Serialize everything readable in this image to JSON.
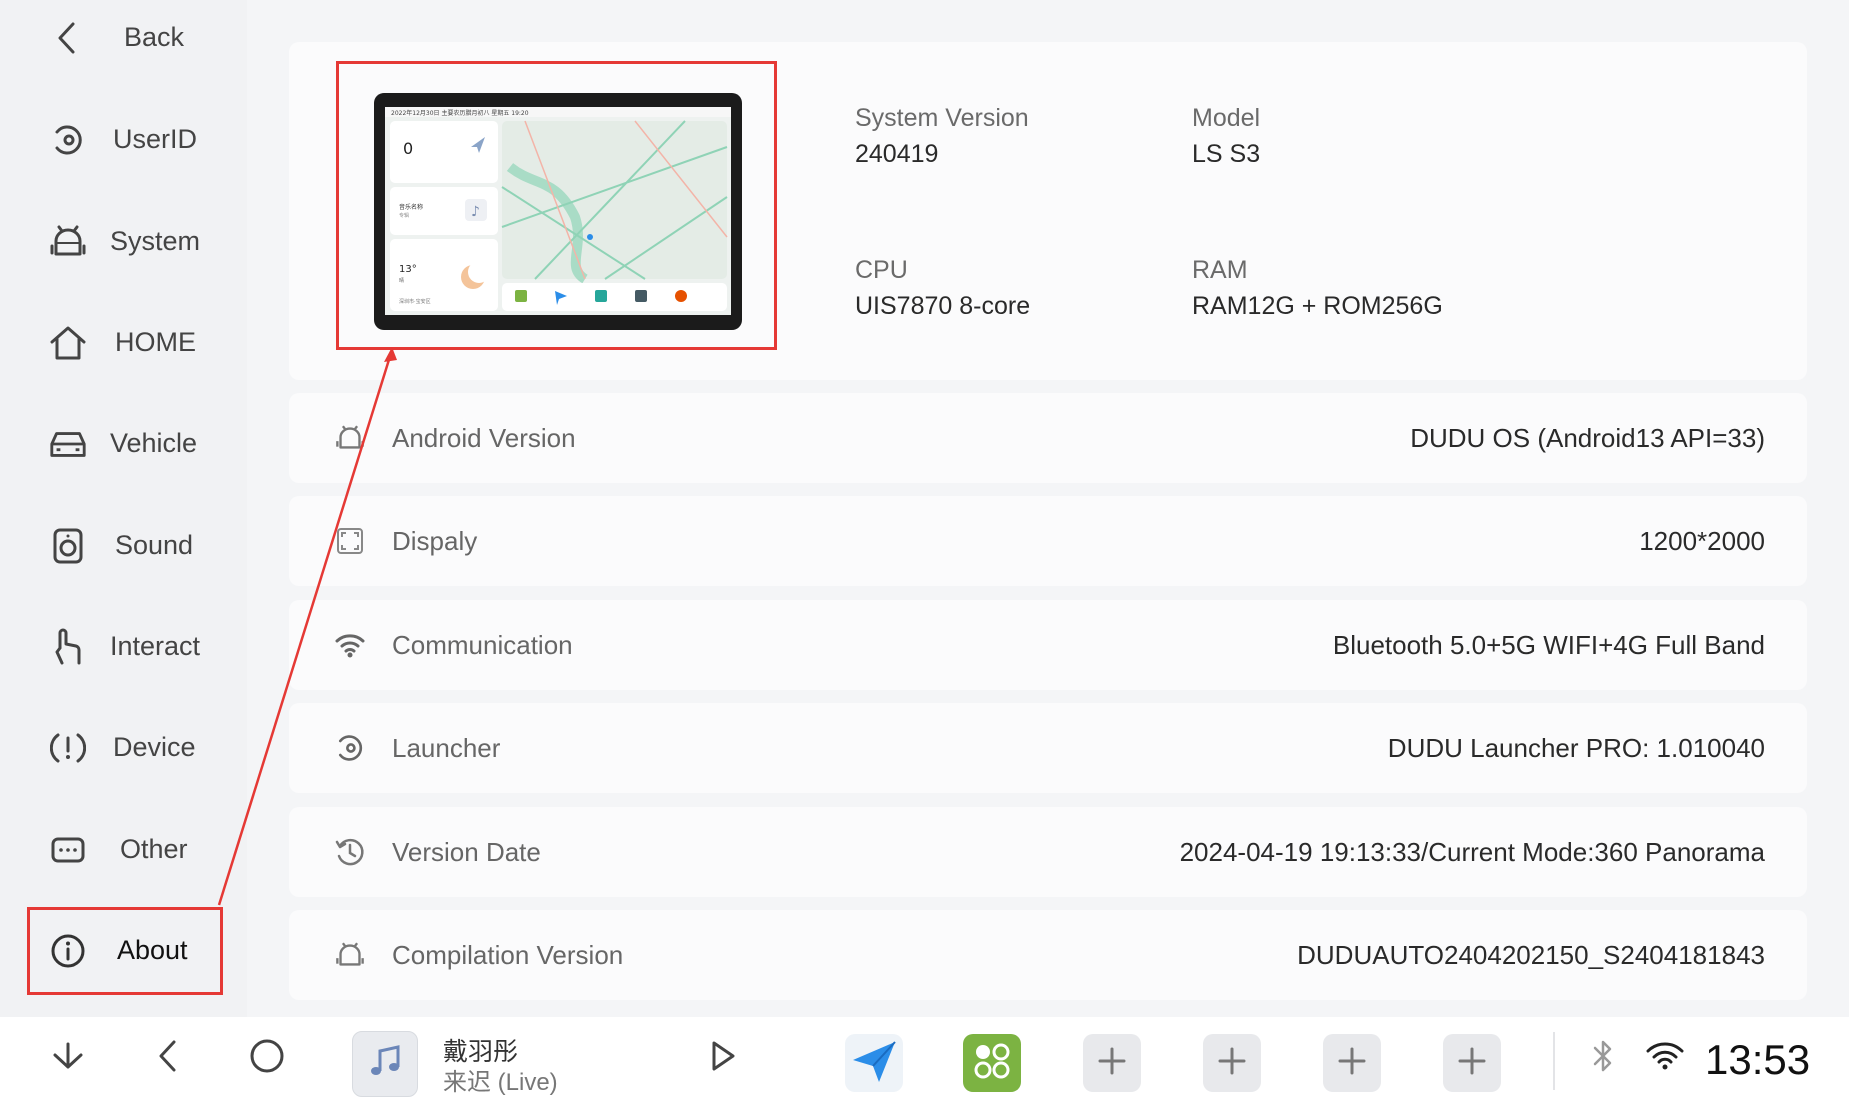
{
  "sidebar": {
    "items": [
      {
        "label": "Back",
        "icon": "chevron-left-icon"
      },
      {
        "label": "UserID",
        "icon": "userid-icon"
      },
      {
        "label": "System",
        "icon": "android-icon"
      },
      {
        "label": "HOME",
        "icon": "home-icon"
      },
      {
        "label": "Vehicle",
        "icon": "car-icon"
      },
      {
        "label": "Sound",
        "icon": "speaker-icon"
      },
      {
        "label": "Interact",
        "icon": "touch-icon"
      },
      {
        "label": "Device",
        "icon": "device-alert-icon"
      },
      {
        "label": "Other",
        "icon": "keyboard-icon"
      },
      {
        "label": "About",
        "icon": "info-icon"
      }
    ],
    "active": "About"
  },
  "specs": {
    "system_version_label": "System Version",
    "system_version_value": "240419",
    "model_label": "Model",
    "model_value": "LS S3",
    "cpu_label": "CPU",
    "cpu_value": "UIS7870 8-core",
    "ram_label": "RAM",
    "ram_value": "RAM12G + ROM256G"
  },
  "preview": {
    "status_text": "2022年12月30日 主要农历腊月初八 星期五 19:20",
    "speed": "0",
    "music_title": "音乐名称",
    "music_artist": "专辑",
    "weather_temp": "13°",
    "weather_desc": "晴",
    "location": "深圳市·宝安区"
  },
  "rows": [
    {
      "label": "Android Version",
      "value": "DUDU OS (Android13 API=33)",
      "icon": "android-icon"
    },
    {
      "label": "Dispaly",
      "value": "1200*2000",
      "icon": "display-icon"
    },
    {
      "label": "Communication",
      "value": "Bluetooth 5.0+5G WIFI+4G Full Band",
      "icon": "wifi-icon"
    },
    {
      "label": "Launcher",
      "value": "DUDU Launcher PRO: 1.010040",
      "icon": "launcher-icon"
    },
    {
      "label": "Version Date",
      "value": "2024-04-19 19:13:33/Current Mode:360 Panorama",
      "icon": "history-icon"
    },
    {
      "label": "Compilation Version",
      "value": "DUDUAUTO2404202150_S2404181843",
      "icon": "android-icon"
    }
  ],
  "bottombar": {
    "song_title": "戴羽彤",
    "song_artist": "来迟 (Live)",
    "clock": "13:53"
  },
  "colors": {
    "highlight": "#e53935",
    "nav_app": "#2b8de8",
    "green_app": "#7cb342"
  }
}
